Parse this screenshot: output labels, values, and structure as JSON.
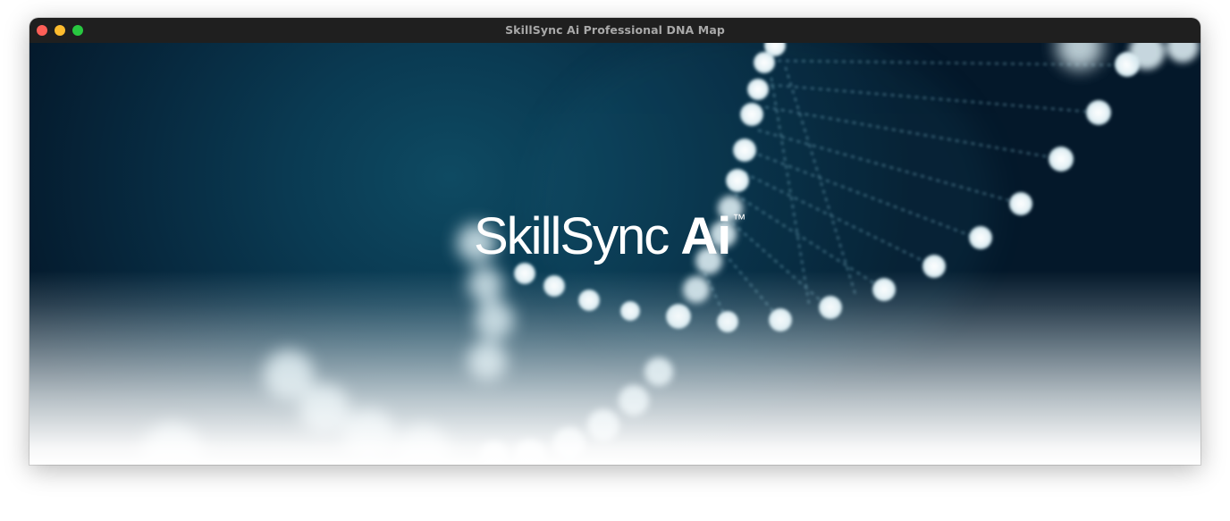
{
  "window": {
    "title": "SkillSync Ai Professional DNA Map"
  },
  "logo": {
    "light_text": "SkillSync ",
    "bold_text": "Ai",
    "trademark": "™"
  },
  "colors": {
    "background_deep": "#04182a",
    "background_glow": "#0e4a62",
    "node": "#e8f4f8",
    "titlebar": "#1f1f1f"
  },
  "icons": {
    "close": "close-traffic-light-icon",
    "minimize": "minimize-traffic-light-icon",
    "maximize": "maximize-traffic-light-icon"
  }
}
